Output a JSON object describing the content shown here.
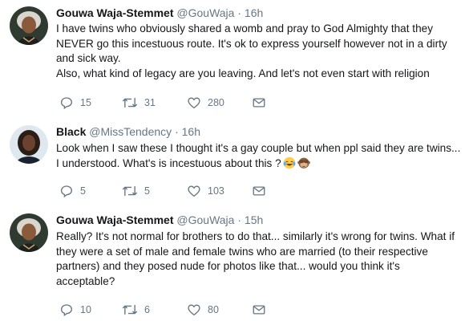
{
  "tweets": [
    {
      "author_name": "Gouwa Waja-Stemmet",
      "handle": "@GouWaja",
      "separator": "·",
      "time": "16h",
      "paragraphs": [
        "I have twins who obviously shared a womb and pray to God Almighty that they NEVER go this incestuous route. It's ok to express yourself however not in a dirty and sick way.",
        "Also, what kind of legacy are you leaving. And let's not even start with religion"
      ],
      "replies": "15",
      "retweets": "31",
      "likes": "280"
    },
    {
      "author_name": "Black",
      "handle": "@MissTendency",
      "separator": "·",
      "time": "16h",
      "paragraphs": [
        "Look when I saw these I thought it's a gay couple but when ppl said they are twins... I understood. What's is incestuous about this ?"
      ],
      "emojis": [
        "face-with-tears-of-joy",
        "see-no-evil-monkey"
      ],
      "replies": "5",
      "retweets": "5",
      "likes": "103"
    },
    {
      "author_name": "Gouwa Waja-Stemmet",
      "handle": "@GouWaja",
      "separator": "·",
      "time": "15h",
      "paragraphs": [
        "Really? It's not normal for brothers to do that... similarly it's wrong for twins. What if they were a set of male and female twins who are married (to their respective partners) and they posed nude for photos like that... would you think it's acceptable?"
      ],
      "replies": "10",
      "retweets": "6",
      "likes": "80"
    }
  ],
  "icons": {
    "reply": "reply-icon",
    "retweet": "retweet-icon",
    "like": "heart-icon",
    "dm": "envelope-icon"
  },
  "colors": {
    "text": "#14171a",
    "muted": "#657786",
    "divider": "#e6ecf0"
  }
}
